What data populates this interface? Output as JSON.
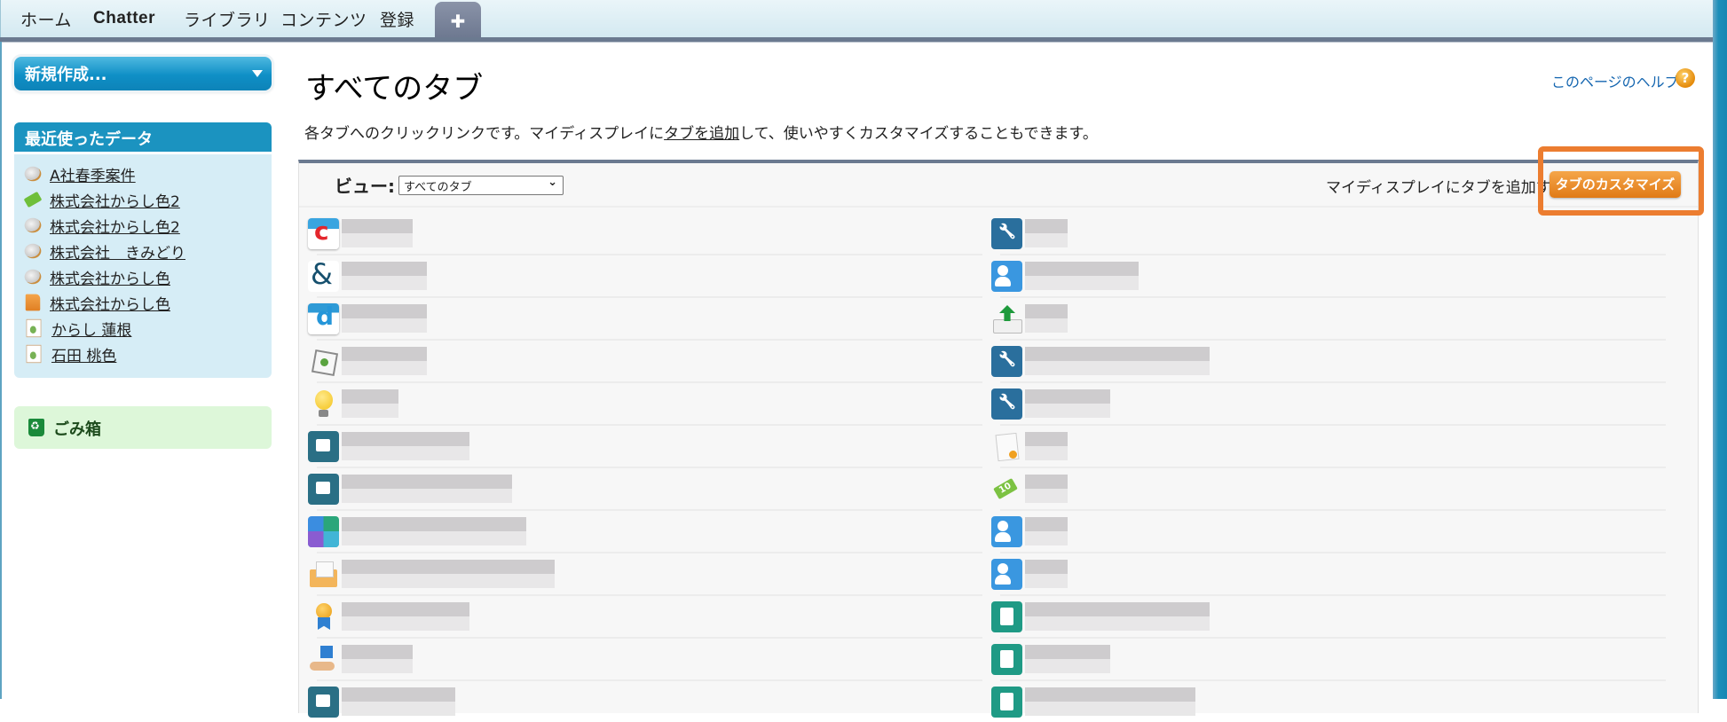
{
  "top_tabs": [
    {
      "label": "ホーム"
    },
    {
      "label": "Chatter"
    },
    {
      "label": "ライブラリ"
    },
    {
      "label": "コンテンツ"
    },
    {
      "label": "登録"
    }
  ],
  "plus_tab": {
    "icon": "plus-icon",
    "glyph": "✚"
  },
  "sidebar": {
    "new_button_label": "新規作成...",
    "recent_title": "最近使ったデータ",
    "recent_items": [
      {
        "label": "A社春季案件",
        "icon": "opportunity-icon"
      },
      {
        "label": "株式会社からし色2",
        "icon": "price-tag-icon"
      },
      {
        "label": "株式会社からし色2",
        "icon": "opportunity-icon"
      },
      {
        "label": "株式会社　きみどり",
        "icon": "opportunity-icon"
      },
      {
        "label": "株式会社からし色",
        "icon": "opportunity-icon"
      },
      {
        "label": "株式会社からし色",
        "icon": "account-folder-icon"
      },
      {
        "label": "からし 蓮根",
        "icon": "contact-icon"
      },
      {
        "label": "石田 桃色",
        "icon": "contact-icon"
      }
    ],
    "trash_label": "ごみ箱"
  },
  "main": {
    "title": "すべてのタブ",
    "help_link": "このページのヘルプ",
    "help_icon_glyph": "?",
    "description_before": "各タブへのクリックリンクです。マイディスプレイに",
    "description_link": "タブを追加",
    "description_after": "して、使いやすくカスタマイズすることもできます。",
    "view_label": "ビュー:",
    "view_selected": "すべてのタブ",
    "view_chevron": "⌄",
    "add_tab_text": "マイディスプレイにタブを追加する",
    "customize_button": "タブのカスタマイズ",
    "highlight_color": "#ec7d30"
  },
  "tab_list": {
    "label_note": "tab labels are pixelated/redacted in the screenshot",
    "left_column": [
      {
        "icon": "c-logo-icon",
        "label_redacted": true,
        "label_len": 5
      },
      {
        "icon": "ampersand-logo-icon",
        "label_redacted": true,
        "label_len": 6
      },
      {
        "icon": "d-logo-icon",
        "label_redacted": true,
        "label_len": 6
      },
      {
        "icon": "network-nodes-icon",
        "label_redacted": true,
        "label_len": 6
      },
      {
        "icon": "lightbulb-icon",
        "label_redacted": true,
        "label_len": 4
      },
      {
        "icon": "document-edit-icon",
        "label_redacted": true,
        "label_len": 9
      },
      {
        "icon": "document-link-icon",
        "label_redacted": true,
        "label_len": 12
      },
      {
        "icon": "app-launcher-icon",
        "label_redacted": true,
        "label_len": 13
      },
      {
        "icon": "open-envelope-icon",
        "label_redacted": true,
        "label_len": 15
      },
      {
        "icon": "award-ribbon-icon",
        "label_redacted": true,
        "label_len": 9
      },
      {
        "icon": "hand-cube-icon",
        "label_redacted": true,
        "label_len": 5
      },
      {
        "icon": "document-edit-icon",
        "label_redacted": true,
        "label_len": 8
      }
    ],
    "right_column": [
      {
        "icon": "document-wrench-icon",
        "label_redacted": true,
        "label_len": 3
      },
      {
        "icon": "user-stack-icon",
        "label_redacted": true,
        "label_len": 8
      },
      {
        "icon": "upload-tray-icon",
        "label_redacted": true,
        "label_len": 3
      },
      {
        "icon": "document-wrench-icon",
        "label_redacted": true,
        "label_len": 13
      },
      {
        "icon": "document-wrench-icon",
        "label_redacted": true,
        "label_len": 6
      },
      {
        "icon": "contract-icon",
        "label_redacted": true,
        "label_len": 3
      },
      {
        "icon": "price-tag-icon",
        "label_redacted": true,
        "label_len": 3
      },
      {
        "icon": "user-stack-icon",
        "label_redacted": true,
        "label_len": 3
      },
      {
        "icon": "user-stack-icon",
        "label_redacted": true,
        "label_len": 3
      },
      {
        "icon": "clipboard-copy-icon",
        "label_redacted": true,
        "label_len": 13
      },
      {
        "icon": "clipboard-list-icon",
        "label_redacted": true,
        "label_len": 6
      },
      {
        "icon": "clipboard-list-icon",
        "label_redacted": true,
        "label_len": 12
      }
    ]
  }
}
